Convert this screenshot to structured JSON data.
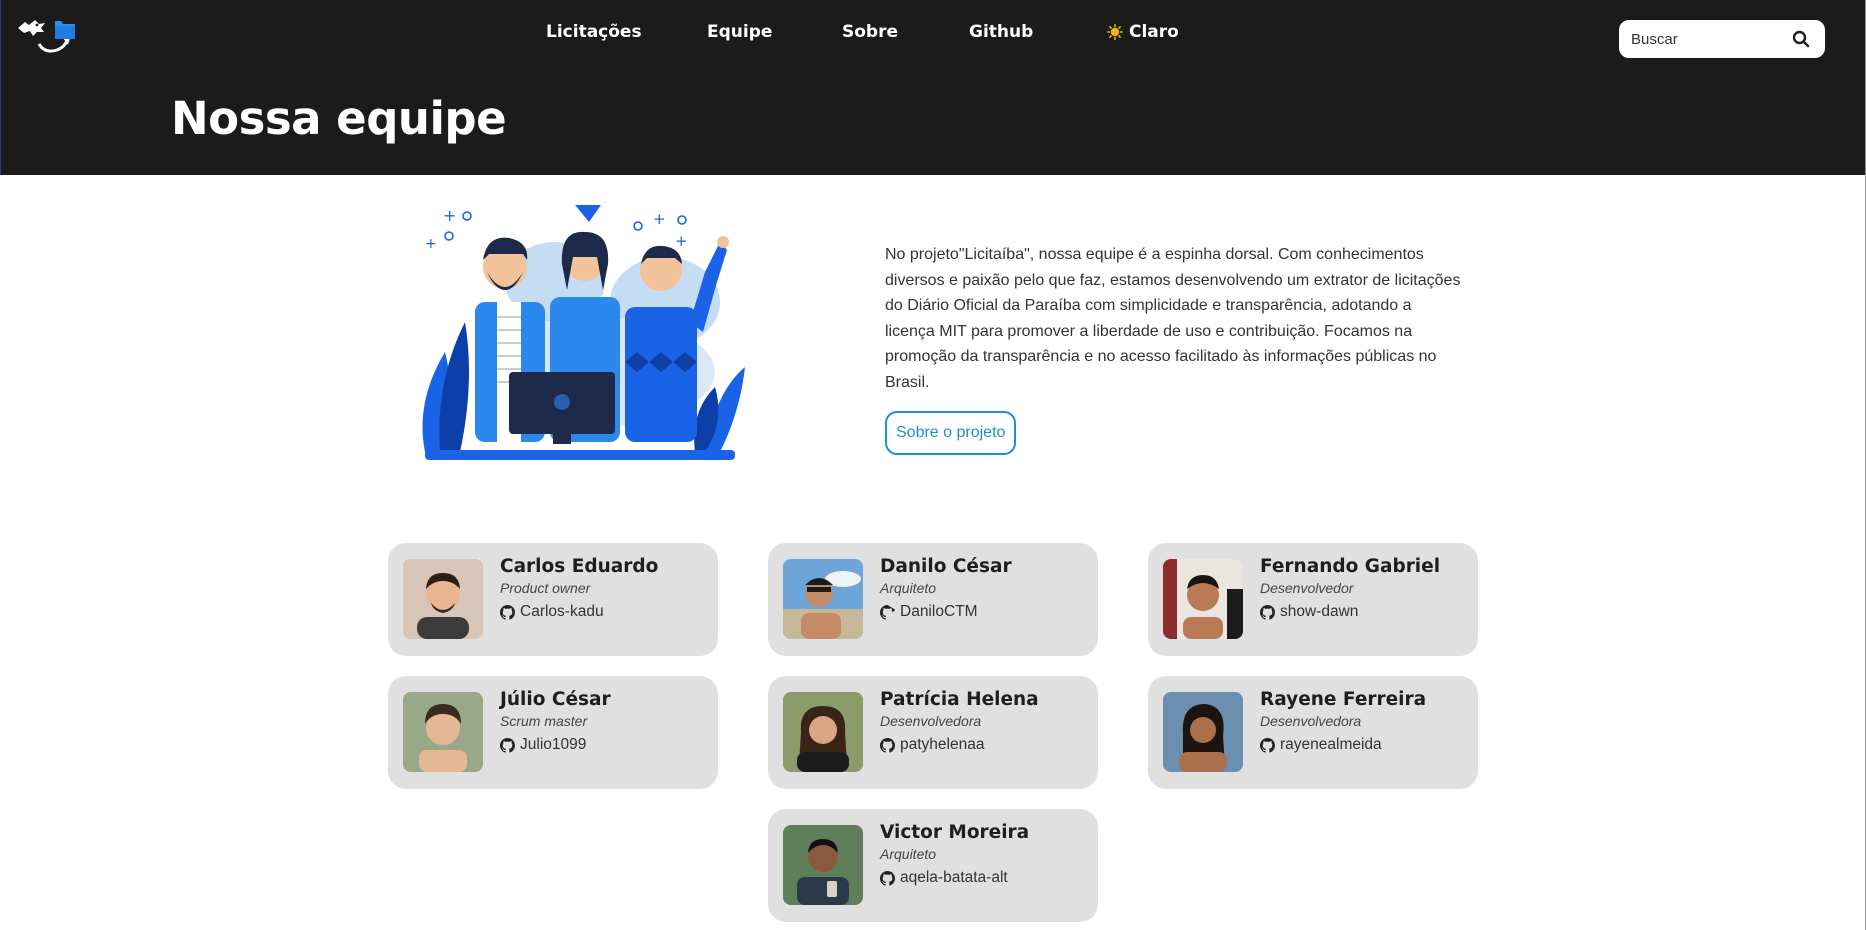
{
  "header": {
    "logo_icon": "bird-folder-logo",
    "nav": [
      {
        "label": "Licitações"
      },
      {
        "label": "Equipe"
      },
      {
        "label": "Sobre"
      },
      {
        "label": "Github"
      }
    ],
    "theme_toggle": {
      "label": "Claro",
      "icon": "sun-icon"
    },
    "search": {
      "placeholder": "Buscar",
      "value": ""
    },
    "page_title": "Nossa equipe"
  },
  "intro": {
    "text": "No projeto\"Licitaíba\", nossa equipe é a espinha dorsal. Com conhecimentos diversos e paixão pelo que faz, estamos desenvolvendo um extrator de licitações do Diário Oficial da Paraíba com simplicidade e transparência, adotando a licença MIT para promover a liberdade de uso e contribuição. Focamos na promoção da transparência e no acesso facilitado às informações públicas no Brasil.",
    "button_label": "Sobre o projeto"
  },
  "team": [
    {
      "name": "Carlos Eduardo",
      "role": "Product owner",
      "github": "Carlos-kadu"
    },
    {
      "name": "Danilo César",
      "role": "Arquiteto",
      "github": "DaniloCTM"
    },
    {
      "name": "Fernando Gabriel",
      "role": "Desenvolvedor",
      "github": "show-dawn"
    },
    {
      "name": "Júlio César",
      "role": "Scrum master",
      "github": "Julio1099"
    },
    {
      "name": "Patrícia Helena",
      "role": "Desenvolvedora",
      "github": "patyhelenaa"
    },
    {
      "name": "Rayene Ferreira",
      "role": "Desenvolvedora",
      "github": "rayenealmeida"
    },
    {
      "name": "Victor Moreira",
      "role": "Arquiteto",
      "github": "aqela-batata-alt"
    }
  ],
  "colors": {
    "header_bg": "#1b1b1b",
    "card_bg": "#e0e0e0",
    "accent": "#1e8fd8",
    "illustration_blue": "#1a63e6"
  }
}
